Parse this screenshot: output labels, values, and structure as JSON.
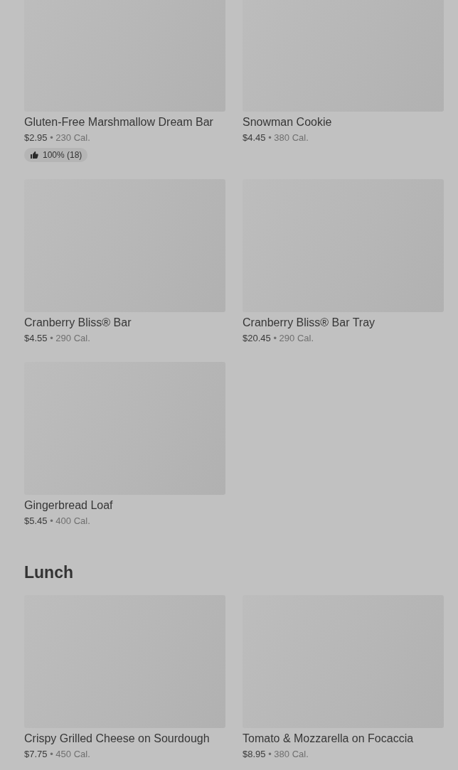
{
  "sections": [
    {
      "items": [
        {
          "name": "Gluten-Free Marshmallow Dream Bar",
          "price": "$2.95",
          "separator": "•",
          "calories": "230 Cal.",
          "rating": "100% (18)"
        },
        {
          "name": "Snowman Cookie",
          "price": "$4.45",
          "separator": "•",
          "calories": "380 Cal."
        },
        {
          "name": "Cranberry Bliss® Bar",
          "price": "$4.55",
          "separator": "•",
          "calories": "290 Cal."
        },
        {
          "name": "Cranberry Bliss® Bar Tray",
          "price": "$20.45",
          "separator": "•",
          "calories": "290 Cal."
        },
        {
          "name": "Gingerbread Loaf",
          "price": "$5.45",
          "separator": "•",
          "calories": "400 Cal."
        }
      ]
    },
    {
      "title": "Lunch",
      "items": [
        {
          "name": "Crispy Grilled Cheese on Sourdough",
          "price": "$7.75",
          "separator": "•",
          "calories": "450 Cal."
        },
        {
          "name": "Tomato & Mozzarella on Focaccia",
          "price": "$8.95",
          "separator": "•",
          "calories": "380 Cal."
        }
      ]
    }
  ]
}
